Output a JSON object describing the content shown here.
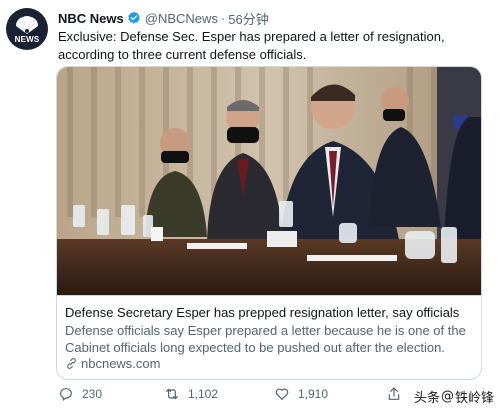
{
  "tweet": {
    "display_name": "NBC News",
    "handle": "@NBCNews",
    "separator": "·",
    "timestamp": "56分钟",
    "text": "Exclusive: Defense Sec. Esper has prepared a letter of resignation, according to three current defense officials.",
    "avatar": {
      "label": "NEWS",
      "icon": "peacock-logo"
    },
    "verified_icon": "verified-badge-icon"
  },
  "card": {
    "title": "Defense Secretary Esper has prepped resignation letter, say officials",
    "description": "Defense officials say Esper prepared a letter because he is one of the Cabinet officials long expected to be pushed out after the election.",
    "domain": "nbcnews.com",
    "domain_icon": "link-icon"
  },
  "actions": {
    "reply_count": "230",
    "retweet_count": "1,102",
    "like_count": "1,910",
    "share_icon": "share-icon"
  },
  "watermark": {
    "source": "头条",
    "at": "@",
    "author": "铁岭锋"
  },
  "colors": {
    "verified": "#1d9bf0",
    "text_primary": "#0f1419",
    "text_secondary": "#536471",
    "border": "#cfd9de"
  }
}
